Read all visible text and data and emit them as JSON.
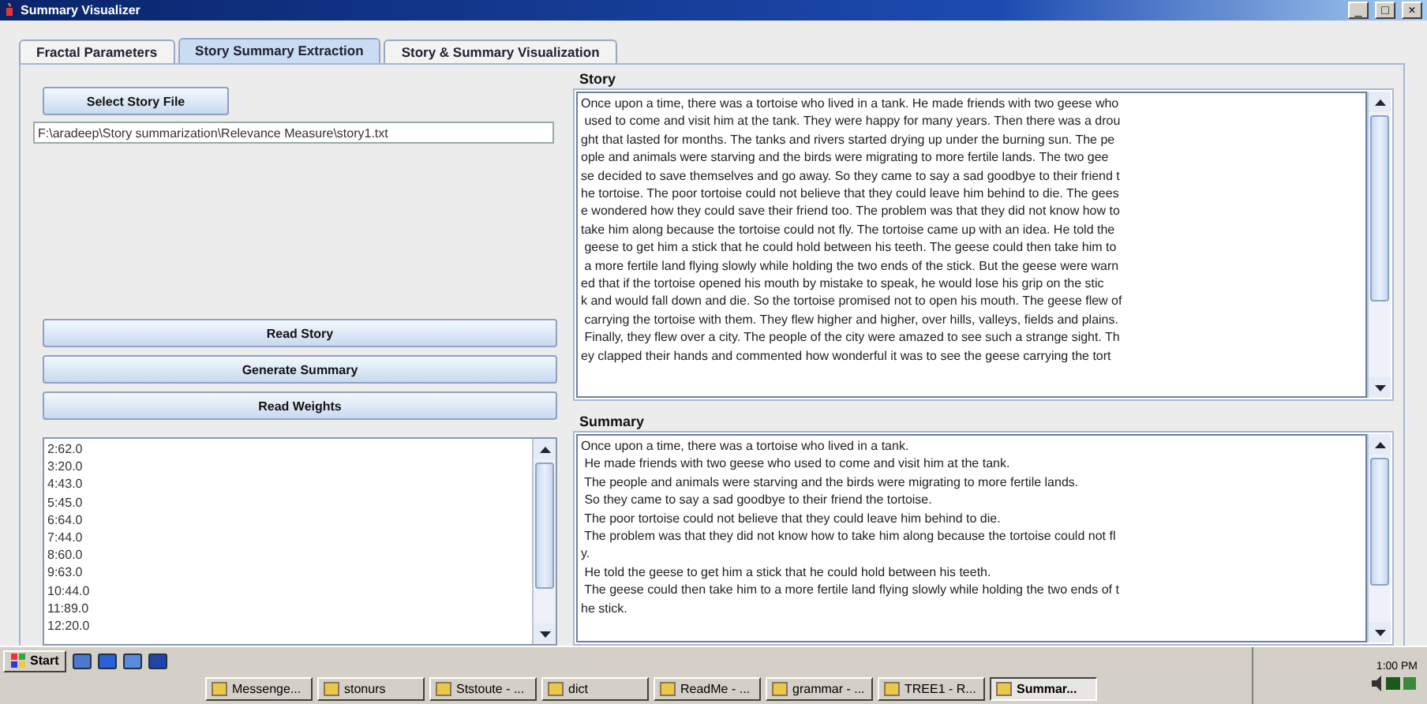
{
  "window": {
    "title": "Summary Visualizer",
    "controls": [
      "_",
      "□",
      "×"
    ]
  },
  "tabs": [
    {
      "label": "Fractal Parameters",
      "selected": false
    },
    {
      "label": "Story Summary Extraction",
      "selected": true
    },
    {
      "label": "Story & Summary Visualization",
      "selected": false
    }
  ],
  "file_panel": {
    "button": "Select Story File",
    "path": "F:\\aradeep\\Story summarization\\Relevance Measure\\story1.txt"
  },
  "actions": [
    "Read Story",
    "Generate Summary",
    "Read Weights"
  ],
  "weights": [
    "2:62.0",
    "3:20.0",
    "4:43.0",
    "5:45.0",
    "6:64.0",
    "7:44.0",
    "8:60.0",
    "9:63.0",
    "10:44.0",
    "11:89.0",
    "12:20.0"
  ],
  "story": {
    "title": "Story",
    "lines": [
      "Once upon a time, there was a tortoise who lived in a tank. He made friends with two geese who",
      " used to come and visit him at the tank. They were happy for many years. Then there was a drou",
      "ght that lasted for months. The tanks and rivers started drying up under the burning sun. The pe",
      "ople and animals were starving and the birds were migrating to more fertile lands. The two gee",
      "se decided to save themselves and go away. So they came to say a sad goodbye to their friend t",
      "he tortoise. The poor tortoise could not believe that they could leave him behind to die. The gees",
      "e wondered how they could save their friend too. The problem was that they did not know how to",
      "take him along because the tortoise could not fly. The tortoise came up with an idea. He told the",
      " geese to get him a stick that he could hold between his teeth. The geese could then take him to",
      " a more fertile land flying slowly while holding the two ends of the stick. But the geese were warn",
      "ed that if the tortoise opened his mouth by mistake to speak, he would lose his grip on the stic",
      "k and would fall down and die. So the tortoise promised not to open his mouth. The geese flew of",
      " carrying the tortoise with them. They flew higher and higher, over hills, valleys, fields and plains.",
      " Finally, they flew over a city. The people of the city were amazed to see such a strange sight. Th",
      "ey clapped their hands and commented how wonderful it was to see the geese carrying the tort"
    ]
  },
  "summary": {
    "title": "Summary",
    "lines": [
      "Once upon a time, there was a tortoise who lived in a tank.",
      " He made friends with two geese who used to come and visit him at the tank.",
      " The people and animals were starving and the birds were migrating to more fertile lands.",
      " So they came to say a sad goodbye to their friend the tortoise.",
      " The poor tortoise could not believe that they could leave him behind to die.",
      " The problem was that they did not know how to take him along because the tortoise could not fl",
      "y.",
      " He told the geese to get him a stick that he could hold between his teeth.",
      " The geese could then take him to a more fertile land flying slowly while holding the two ends of t",
      "he stick."
    ]
  },
  "taskbar": {
    "start": "Start",
    "tasks": [
      {
        "label": "Messenge...",
        "selected": false
      },
      {
        "label": "stonurs",
        "selected": false
      },
      {
        "label": "Ststoute - ...",
        "selected": false
      },
      {
        "label": "dict",
        "selected": false
      },
      {
        "label": "ReadMe - ...",
        "selected": false
      },
      {
        "label": "grammar - ...",
        "selected": false
      },
      {
        "label": "TREE1 - R...",
        "selected": false
      },
      {
        "label": "Summar...",
        "selected": true
      }
    ],
    "clock": "1:00 PM"
  }
}
